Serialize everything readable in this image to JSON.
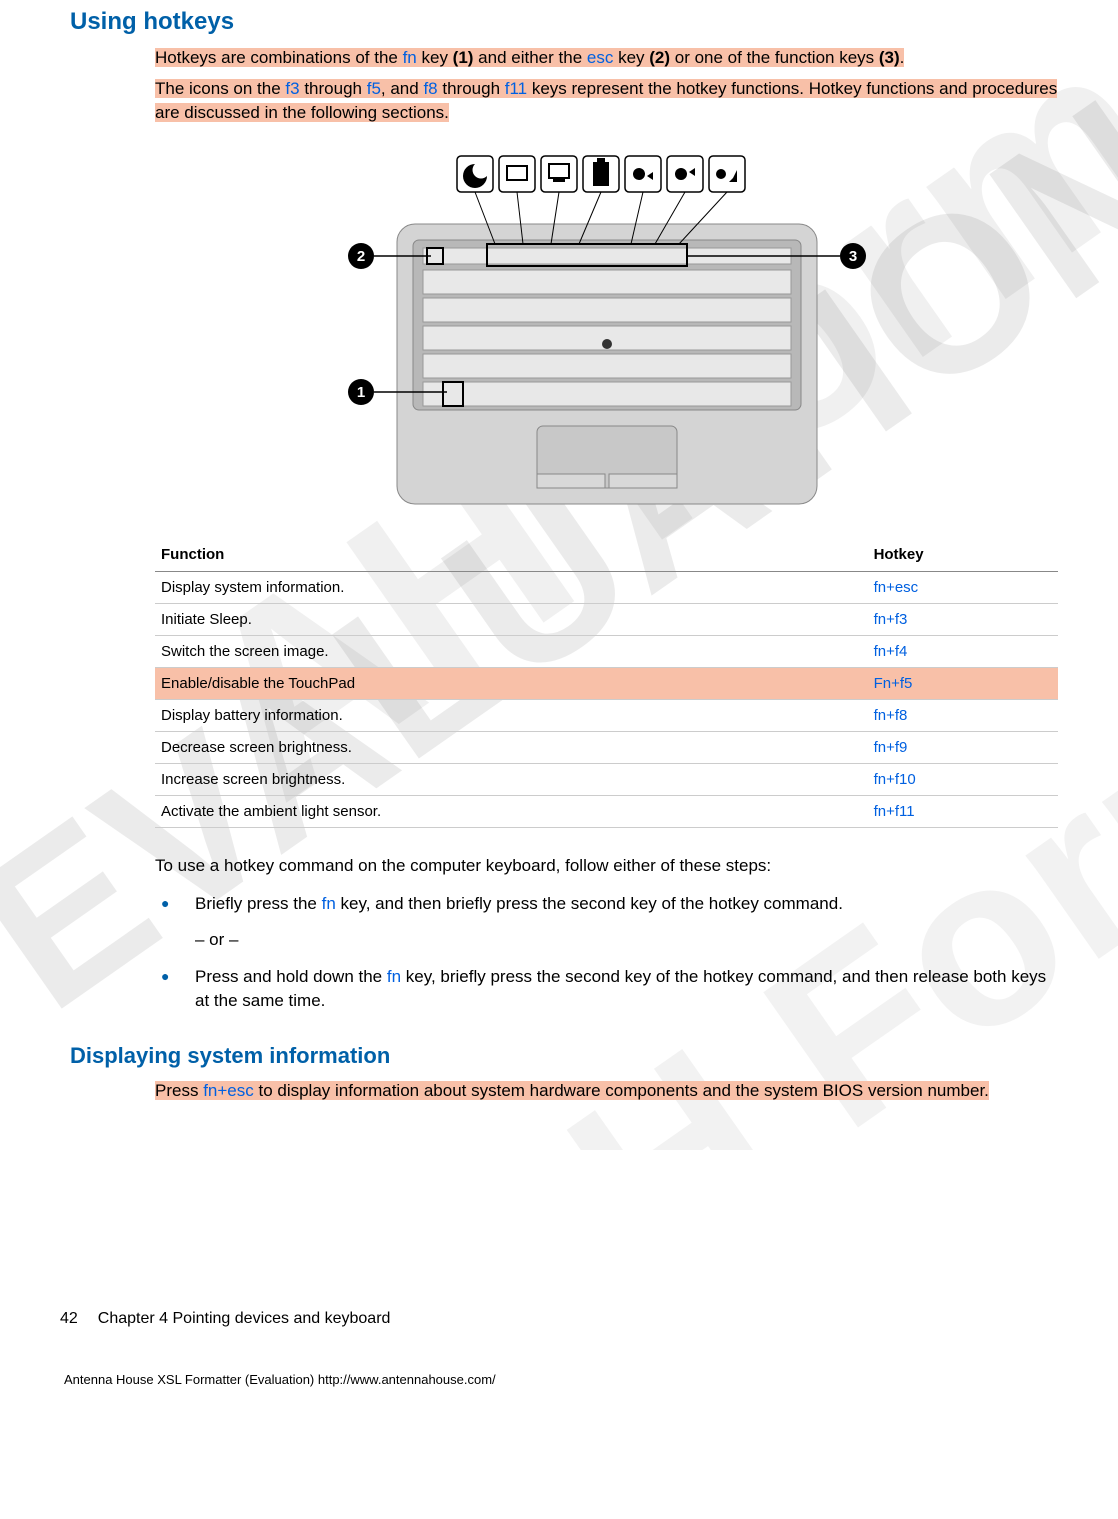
{
  "section_title": "Using hotkeys",
  "intro": {
    "p1_a": "Hotkeys are combinations of the ",
    "p1_fn": "fn",
    "p1_b": " key ",
    "p1_bold1": "(1)",
    "p1_c": " and either the ",
    "p1_esc": "esc",
    "p1_d": " key ",
    "p1_bold2": "(2)",
    "p1_e": " or one of the function keys ",
    "p1_bold3": "(3)",
    "p1_f": ".",
    "p2_a": "The icons on the ",
    "p2_f3": "f3",
    "p2_b": " through ",
    "p2_f5": "f5",
    "p2_c": ", and ",
    "p2_f8": "f8",
    "p2_d": " through ",
    "p2_f11": "f11",
    "p2_e": " keys represent the hotkey functions. Hotkey functions and procedures are discussed in the following sections."
  },
  "table": {
    "h1": "Function",
    "h2": "Hotkey",
    "rows": [
      {
        "fn": "Display system information.",
        "hk": "fn+esc",
        "hl": false
      },
      {
        "fn": "Initiate Sleep.",
        "hk": "fn+f3",
        "hl": false
      },
      {
        "fn": "Switch the screen image.",
        "hk": "fn+f4",
        "hl": false
      },
      {
        "fn": "Enable/disable the TouchPad",
        "hk": "Fn+f5",
        "hl": true
      },
      {
        "fn": "Display battery information.",
        "hk": "fn+f8",
        "hl": false
      },
      {
        "fn": "Decrease screen brightness.",
        "hk": "fn+f9",
        "hl": false
      },
      {
        "fn": "Increase screen brightness.",
        "hk": "fn+f10",
        "hl": false
      },
      {
        "fn": "Activate the ambient light sensor.",
        "hk": "fn+f11",
        "hl": false
      }
    ]
  },
  "usage_intro": "To use a hotkey command on the computer keyboard, follow either of these steps:",
  "bullets": {
    "b1_a": "Briefly press the ",
    "b1_fn": "fn",
    "b1_b": " key, and then briefly press the second key of the hotkey command.",
    "or": "– or –",
    "b2_a": "Press and hold down the ",
    "b2_fn": "fn",
    "b2_b": " key, briefly press the second key of the hotkey command, and then release both keys at the same time."
  },
  "subsection_title": "Displaying system information",
  "sub_para": {
    "a": "Press ",
    "hk": "fn+esc",
    "b": " to display information about system hardware components and the system BIOS version number."
  },
  "footer": {
    "page": "42",
    "chapter": "Chapter 4   Pointing devices and keyboard"
  },
  "eval_line": "Antenna House XSL Formatter (Evaluation)  http://www.antennahouse.com/",
  "callouts": {
    "c1": "1",
    "c2": "2",
    "c3": "3"
  }
}
